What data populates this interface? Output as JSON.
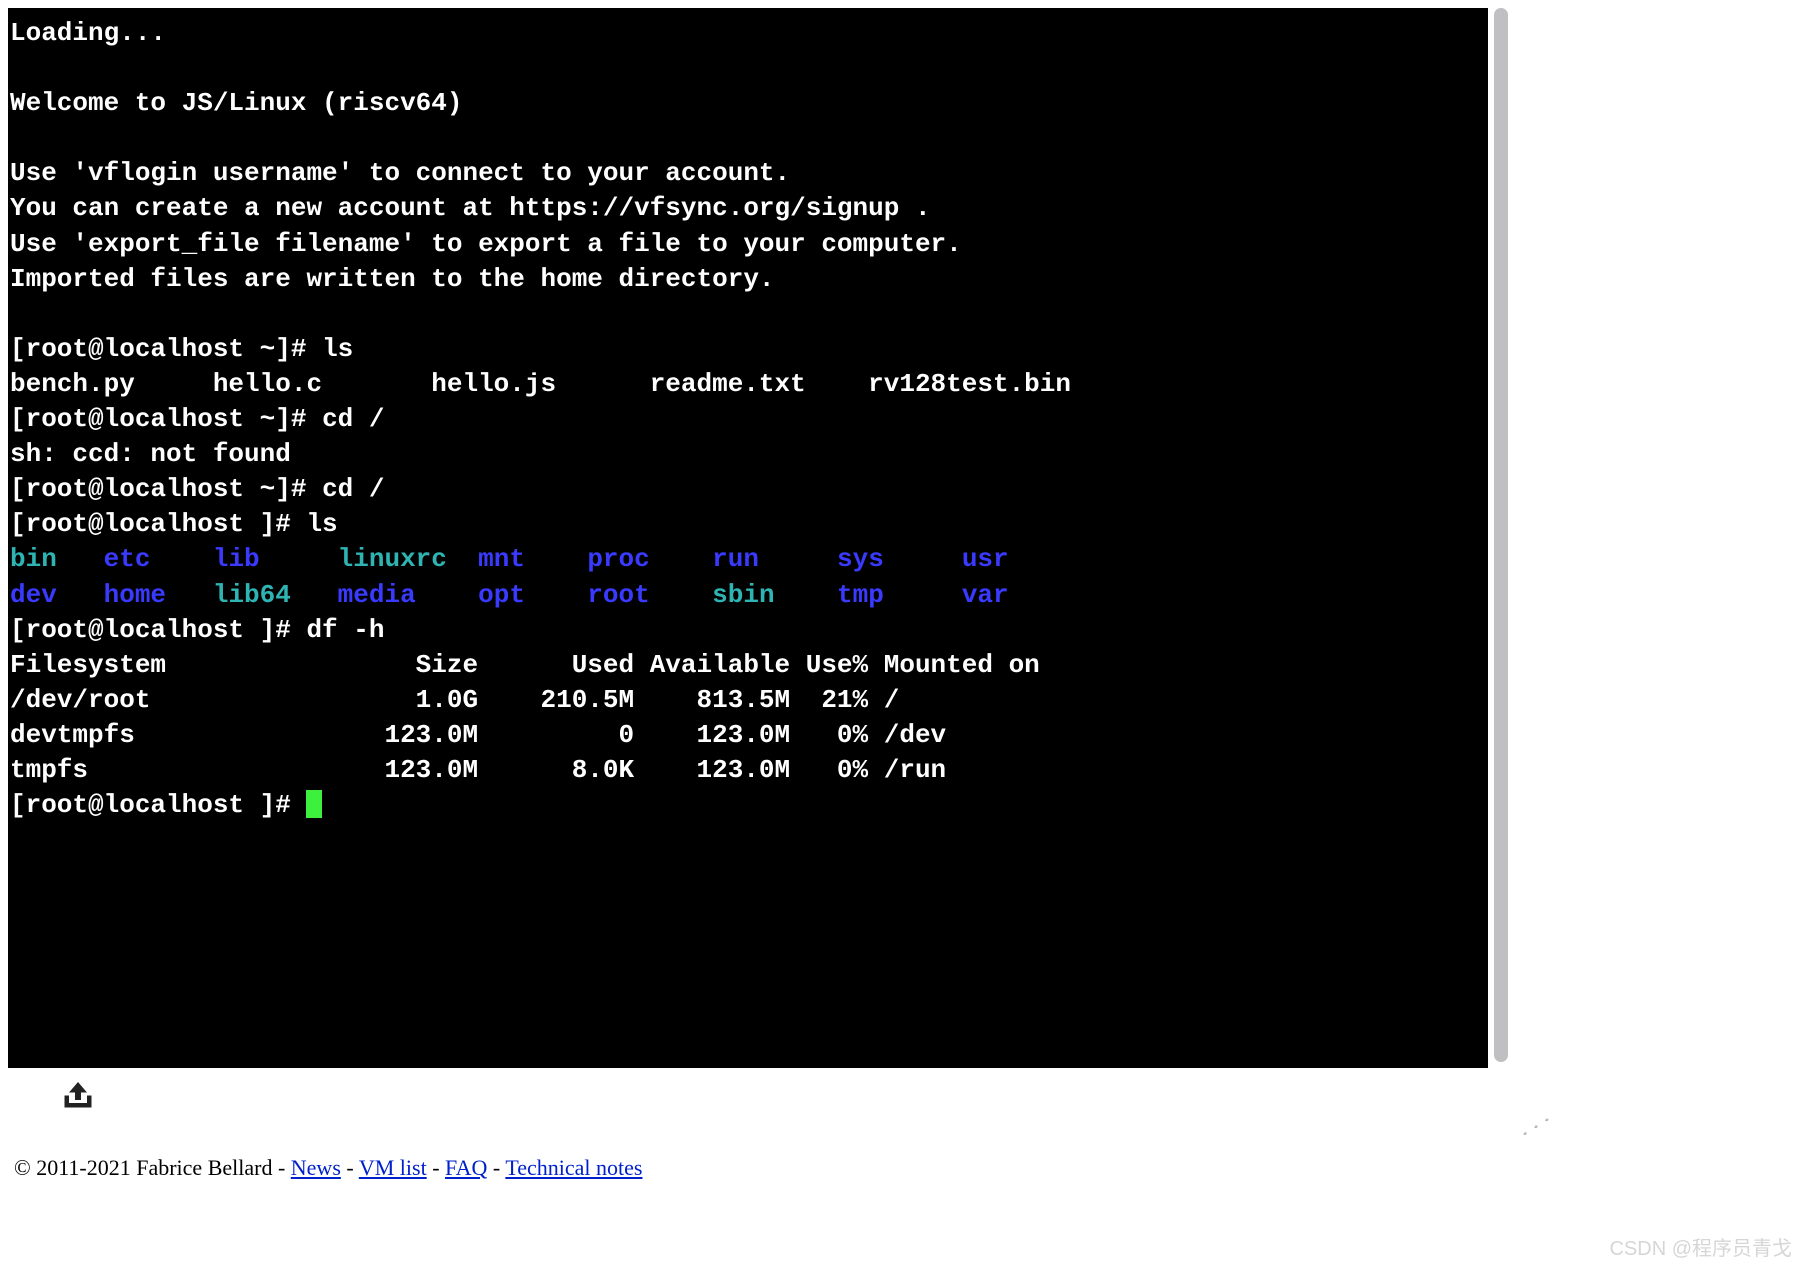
{
  "terminal": {
    "loading": "Loading...",
    "welcome": "Welcome to JS/Linux (riscv64)",
    "help1": "Use 'vflogin username' to connect to your account.",
    "help2": "You can create a new account at https://vfsync.org/signup .",
    "help3": "Use 'export_file filename' to export a file to your computer.",
    "help4": "Imported files are written to the home directory.",
    "prompt_home": "[root@localhost ~]# ",
    "prompt_root": "[root@localhost ]# ",
    "cmd_ls1": "ls",
    "ls_home_line": "bench.py     hello.c       hello.js      readme.txt    rv128test.bin",
    "cmd_cd_typo": "cd /",
    "err_ccd": "sh: ccd: not found",
    "cmd_cd": "cd /",
    "cmd_ls2": "ls",
    "root_dirs_row1": [
      {
        "name": "bin",
        "class": "dir-teal"
      },
      {
        "name": "etc",
        "class": "dir-blue"
      },
      {
        "name": "lib",
        "class": "dir-blue"
      },
      {
        "name": "linuxrc",
        "class": "dir-teal"
      },
      {
        "name": "mnt",
        "class": "dir-blue"
      },
      {
        "name": "proc",
        "class": "dir-blue"
      },
      {
        "name": "run",
        "class": "dir-blue"
      },
      {
        "name": "sys",
        "class": "dir-blue"
      },
      {
        "name": "usr",
        "class": "dir-blue"
      }
    ],
    "root_dirs_row2": [
      {
        "name": "dev",
        "class": "dir-blue"
      },
      {
        "name": "home",
        "class": "dir-blue"
      },
      {
        "name": "lib64",
        "class": "dir-teal"
      },
      {
        "name": "media",
        "class": "dir-blue"
      },
      {
        "name": "opt",
        "class": "dir-blue"
      },
      {
        "name": "root",
        "class": "dir-blue"
      },
      {
        "name": "sbin",
        "class": "dir-teal"
      },
      {
        "name": "tmp",
        "class": "dir-blue"
      },
      {
        "name": "var",
        "class": "dir-blue"
      }
    ],
    "cmd_df": "df -h",
    "df_header": "Filesystem                Size      Used Available Use% Mounted on",
    "df_rows": [
      "/dev/root                 1.0G    210.5M    813.5M  21% /",
      "devtmpfs                123.0M         0    123.0M   0% /dev",
      "tmpfs                   123.0M      8.0K    123.0M   0% /run"
    ]
  },
  "footer": {
    "copyright": "© 2011-2021 Fabrice Bellard - ",
    "links": [
      {
        "label": "News"
      },
      {
        "label": "VM list"
      },
      {
        "label": "FAQ"
      },
      {
        "label": "Technical notes"
      }
    ],
    "sep": " - "
  },
  "watermark": "CSDN @程序员青戈"
}
